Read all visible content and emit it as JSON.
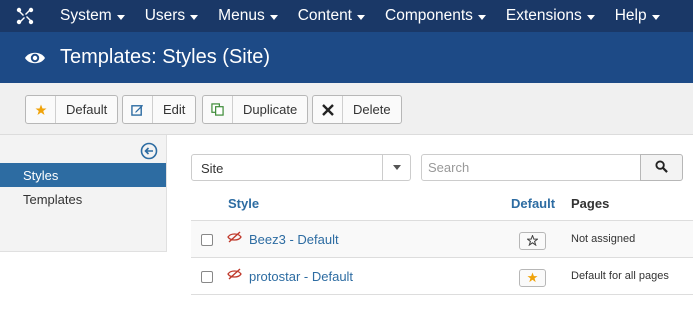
{
  "nav": {
    "items": [
      {
        "label": "System"
      },
      {
        "label": "Users"
      },
      {
        "label": "Menus"
      },
      {
        "label": "Content"
      },
      {
        "label": "Components"
      },
      {
        "label": "Extensions"
      },
      {
        "label": "Help"
      }
    ]
  },
  "header": {
    "title": "Templates: Styles (Site)",
    "icon": "eye-icon"
  },
  "toolbar": {
    "default_label": "Default",
    "edit_label": "Edit",
    "duplicate_label": "Duplicate",
    "delete_label": "Delete"
  },
  "sidebar": {
    "items": [
      {
        "label": "Styles",
        "active": true
      },
      {
        "label": "Templates",
        "active": false
      }
    ]
  },
  "filters": {
    "client_value": "Site",
    "search_placeholder": "Search"
  },
  "table": {
    "headers": {
      "style": "Style",
      "default": "Default",
      "pages": "Pages"
    },
    "rows": [
      {
        "style": "Beez3 - Default",
        "is_default": false,
        "pages": "Not assigned"
      },
      {
        "style": "protostar - Default",
        "is_default": true,
        "pages": "Default for all pages"
      }
    ]
  },
  "colors": {
    "nav_bg": "#1a3867",
    "header_bg": "#1d4a86",
    "accent": "#2d6ca2",
    "star": "#f0a30a",
    "hidden_icon": "#c0392b"
  }
}
